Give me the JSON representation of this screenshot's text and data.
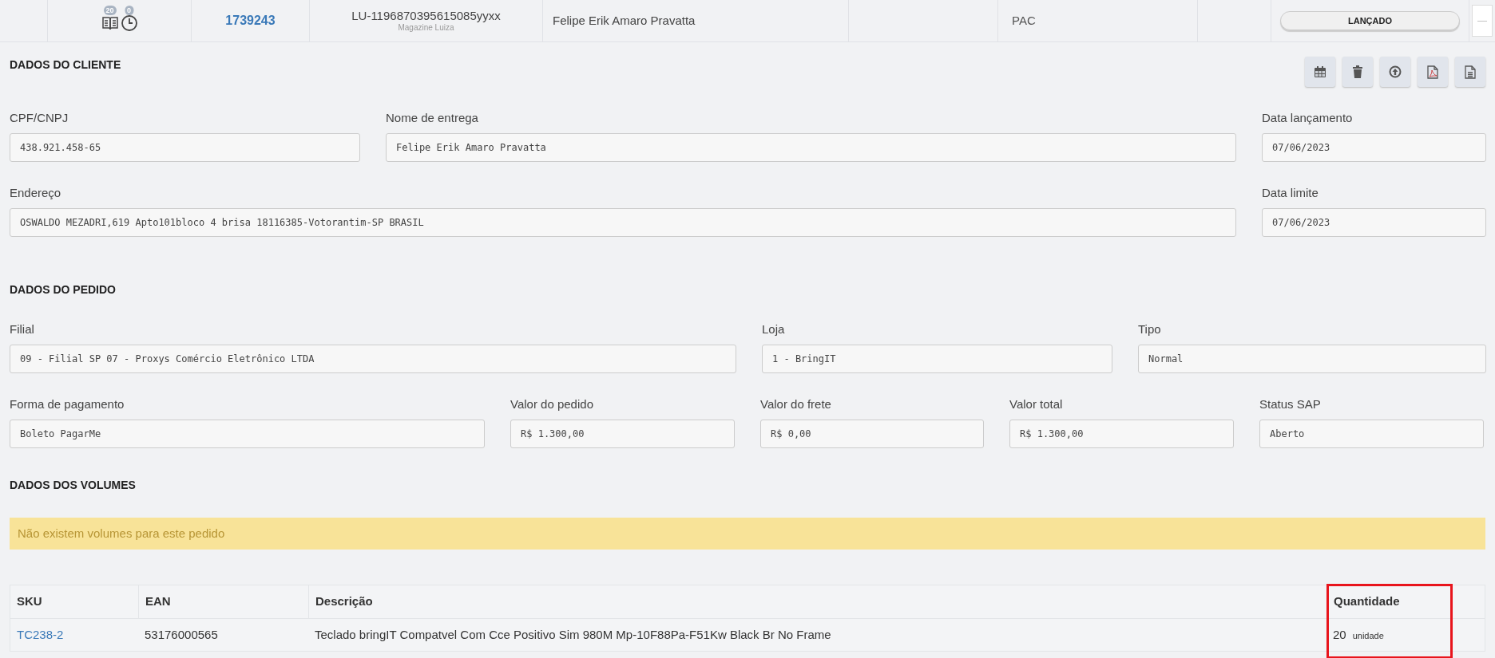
{
  "top_row": {
    "badges": [
      {
        "kind": "book",
        "count": "20"
      },
      {
        "kind": "clock",
        "count": "0"
      }
    ],
    "order_id": "1739243",
    "order_code": "LU-1196870395615085yyxx",
    "channel": "Magazine Luiza",
    "customer": "Felipe Erik Amaro Pravatta",
    "shipping": "PAC",
    "status": "LANÇADO",
    "collapse": "—"
  },
  "client_section": {
    "title": "DADOS DO CLIENTE",
    "actions": [
      {
        "kind": "calendar"
      },
      {
        "kind": "trash"
      },
      {
        "kind": "upload"
      },
      {
        "kind": "pdf"
      },
      {
        "kind": "document"
      }
    ],
    "field_rows": [
      {
        "fields": [
          {
            "label": "CPF/CNPJ",
            "value": "438.921.458-65"
          },
          {
            "label": "Nome de entrega",
            "value": "Felipe Erik Amaro Pravatta"
          },
          {
            "label": "Data lançamento",
            "value": "07/06/2023"
          }
        ]
      },
      {
        "fields": [
          {
            "label": "Endereço",
            "value": "OSWALDO MEZADRI,619 Apto101bloco 4 brisa 18116385-Votorantim-SP BRASIL"
          },
          {
            "label": "Data limite",
            "value": "07/06/2023"
          }
        ]
      }
    ]
  },
  "order_section": {
    "title": "DADOS DO PEDIDO",
    "field_rows": [
      {
        "fields": [
          {
            "label": "Filial",
            "value": "09 - Filial SP 07 - Proxys Comércio Eletrônico LTDA"
          },
          {
            "label": "Loja",
            "value": "1 - BringIT"
          },
          {
            "label": "Tipo",
            "value": "Normal"
          }
        ]
      },
      {
        "fields": [
          {
            "label": "Forma de pagamento",
            "value": "Boleto PagarMe"
          },
          {
            "label": "Valor do pedido",
            "value": "R$ 1.300,00"
          },
          {
            "label": "Valor do frete",
            "value": "R$ 0,00"
          },
          {
            "label": "Valor total",
            "value": "R$ 1.300,00"
          },
          {
            "label": "Status SAP",
            "value": "Aberto"
          }
        ]
      }
    ]
  },
  "volumes_section": {
    "title": "DADOS DOS VOLUMES",
    "alert": "Não existem volumes para este pedido"
  },
  "items_table": {
    "columns": [
      "SKU",
      "EAN",
      "Descrição",
      "Quantidade"
    ],
    "rows": [
      {
        "sku": "TC238-2",
        "ean": "53176000565",
        "description": "Teclado bringIT Compatvel Com Cce Positivo Sim 980M Mp-10F88Pa-F51Kw Black Br No Frame",
        "quantity": "20",
        "unit": "unidade"
      }
    ]
  }
}
